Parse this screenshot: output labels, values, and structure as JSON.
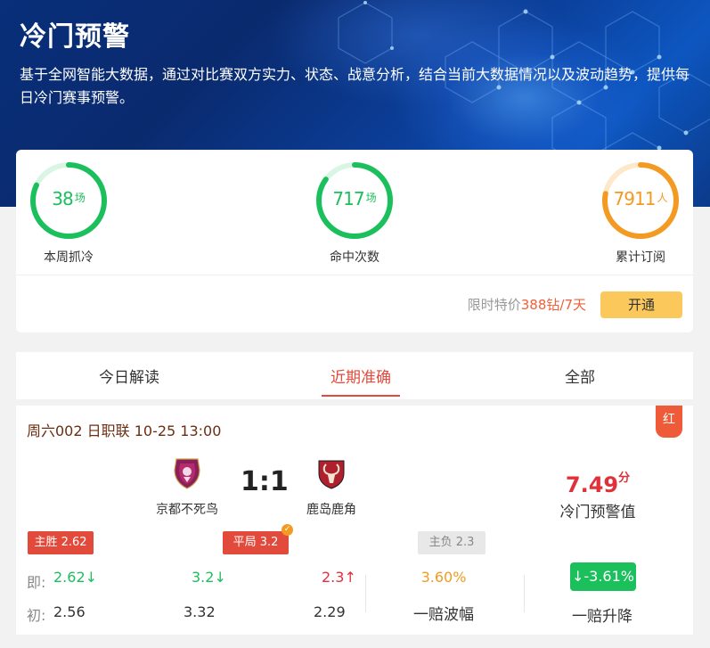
{
  "header": {
    "title": "冷门预警",
    "description": "基于全网智能大数据，通过对比赛双方实力、状态、战意分析，结合当前大数据情况以及波动趋势，提供每日冷门赛事预警。"
  },
  "stats": [
    {
      "value": "38",
      "unit": "场",
      "label": "本周抓冷",
      "color": "#1bbf5c",
      "progress": 0.82
    },
    {
      "value": "717",
      "unit": "场",
      "label": "命中次数",
      "color": "#1bbf5c",
      "progress": 0.85
    },
    {
      "value": "7911",
      "unit": "人",
      "label": "累计订阅",
      "color": "#f39a22",
      "progress": 0.78
    }
  ],
  "promo": {
    "prefix": "限时特价",
    "price": "388钻/7天",
    "button": "开通"
  },
  "tabs": [
    {
      "label": "今日解读",
      "active": false
    },
    {
      "label": "近期准确",
      "active": true
    },
    {
      "label": "全部",
      "active": false
    }
  ],
  "match": {
    "header": "周六002 日职联 10-25 13:00",
    "tag": "红",
    "home": "京都不死鸟",
    "away": "鹿岛鹿角",
    "score": "1:1",
    "warning_value": "7.49",
    "warning_unit": "分",
    "warning_label": "冷门预警值",
    "picks": {
      "home": "主胜 2.62",
      "draw": "平局 3.2",
      "away": "主负 2.3",
      "draw_badge": "✓"
    },
    "current": {
      "label": "即:",
      "home": "2.62↓",
      "draw": "3.2↓",
      "away": "2.3↑"
    },
    "initial": {
      "label": "初:",
      "home": "2.56",
      "draw": "3.32",
      "away": "2.29"
    },
    "wave_value": "3.60%",
    "wave_label": "一赔波幅",
    "drop_value": "↓-3.61%",
    "drop_label": "一赔升降"
  }
}
